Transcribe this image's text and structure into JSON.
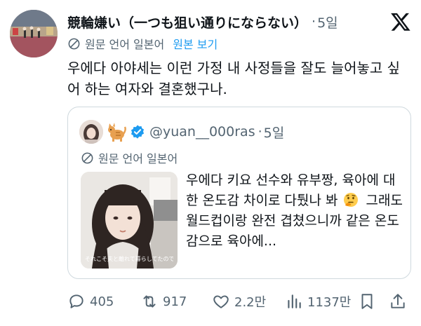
{
  "tweet": {
    "display_name": "競輪嫌い（一つも狙い通りにならない）",
    "separator": "·",
    "time": "5일",
    "translate": {
      "label": "원문 언어 일본어",
      "show_original": "원본 보기"
    },
    "text": "우에다 아야세는 이런 가정 내 사정들을 잘도 늘어놓고 싶어 하는 여자와 결혼했구나."
  },
  "quote": {
    "handle": "@yuan__000ras",
    "separator": "·",
    "time": "5일",
    "translate_label": "원문 언어 일본어",
    "text_before_emoji": "우에다 키요 선수와 유부짱, 육아에 대한 온도감 차이로 다퉜나 봐",
    "text_after_emoji": "그래도 월드컵이랑 완전 겹쳤으니까 같은 온도감으로 육아에...",
    "thumbnail_caption": "それこそ夫と離れて暮らしてたので"
  },
  "actions": {
    "replies": "405",
    "reposts": "917",
    "likes": "2.2만",
    "views": "1137만"
  },
  "colors": {
    "text": "#0f1419",
    "secondary": "#536471",
    "link": "#1d9bf0",
    "border": "#cfd9de",
    "verified": "#1d9bf0"
  },
  "icons": [
    "x-logo-icon",
    "globe-icon",
    "cat-emoji-icon",
    "verified-badge-icon",
    "thinking-face-emoji-icon",
    "reply-icon",
    "repost-icon",
    "like-icon",
    "views-icon",
    "bookmark-icon",
    "share-icon"
  ]
}
